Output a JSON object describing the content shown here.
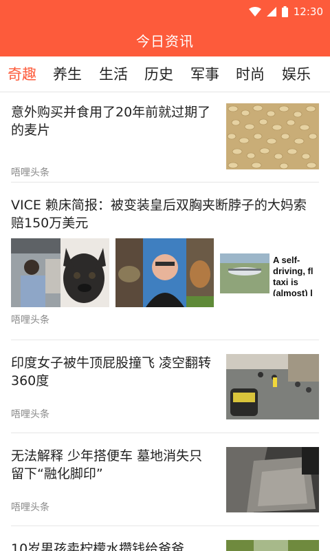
{
  "status": {
    "time": "12:30"
  },
  "app": {
    "title": "今日资讯"
  },
  "tabs": [
    {
      "label": "奇趣",
      "active": true
    },
    {
      "label": "养生"
    },
    {
      "label": "生活"
    },
    {
      "label": "历史"
    },
    {
      "label": "军事"
    },
    {
      "label": "时尚"
    },
    {
      "label": "娱乐"
    }
  ],
  "articles": [
    {
      "title": "意外购买并食用了20年前就过期了的麦片",
      "source": "唔哩头条",
      "image": "oat-cereal"
    },
    {
      "title": "VICE 赖床简报：被变装皇后双胸夹断脖子的大妈索赔150万美元",
      "source": "唔哩头条",
      "images": [
        "airplane-cabin-man",
        "french-bulldog",
        "turtle-in-hand",
        "smiling-man-portrait",
        "puppy-on-grass",
        "small-airplane-ad"
      ],
      "ad_text": "A self-driving, fl taxi is (almost) l"
    },
    {
      "title": "印度女子被牛顶屁股撞飞 凌空翻转360度",
      "source": "唔哩头条",
      "image": "street-cctv"
    },
    {
      "title": "无法解释 少年搭便车 墓地消失只留下“融化脚印”",
      "source": "唔哩头条",
      "image": "car-floor-mat"
    },
    {
      "title": "10岁男孩卖柠檬水攒钱给爸爸",
      "image": "outdoor-scene"
    }
  ]
}
